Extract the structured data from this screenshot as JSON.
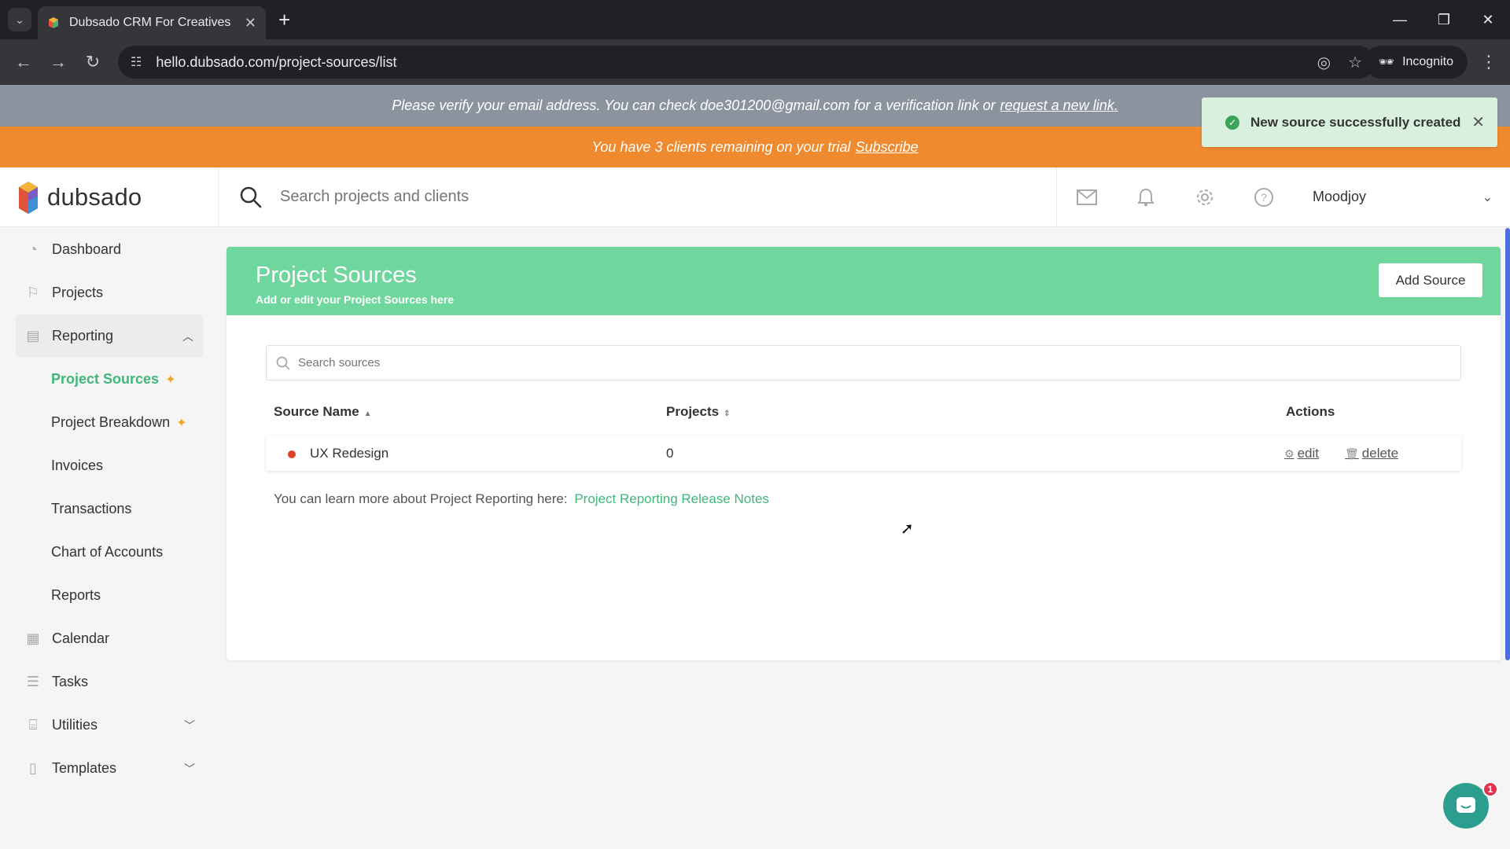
{
  "browser": {
    "tab_title": "Dubsado CRM For Creatives",
    "url": "hello.dubsado.com/project-sources/list",
    "incognito_label": "Incognito"
  },
  "banners": {
    "verify_text": "Please verify your email address. You can check doe301200@gmail.com for a verification link or",
    "verify_link": "request a new link.",
    "trial_text": "You have 3 clients remaining on your trial",
    "trial_link": "Subscribe"
  },
  "toast": {
    "message": "New source successfully created"
  },
  "header": {
    "logo_text": "dubsado",
    "search_placeholder": "Search projects and clients",
    "user_name": "Moodjoy"
  },
  "sidebar": {
    "items": [
      {
        "label": "Dashboard",
        "icon": "dashboard-icon"
      },
      {
        "label": "Projects",
        "icon": "projects-icon"
      },
      {
        "label": "Reporting",
        "icon": "reporting-icon"
      },
      {
        "label": "Project Sources"
      },
      {
        "label": "Project Breakdown"
      },
      {
        "label": "Invoices"
      },
      {
        "label": "Transactions"
      },
      {
        "label": "Chart of Accounts"
      },
      {
        "label": "Reports"
      },
      {
        "label": "Calendar",
        "icon": "calendar-icon"
      },
      {
        "label": "Tasks",
        "icon": "tasks-icon"
      },
      {
        "label": "Utilities",
        "icon": "utilities-icon"
      },
      {
        "label": "Templates",
        "icon": "templates-icon"
      }
    ]
  },
  "main": {
    "title": "Project Sources",
    "subtitle": "Add or edit your Project Sources here",
    "add_button": "Add Source",
    "search_placeholder": "Search sources",
    "columns": [
      "Source Name",
      "Projects",
      "Actions"
    ],
    "rows": [
      {
        "name": "UX Redesign",
        "projects": "0",
        "dot_color": "#e0412a",
        "edit": "edit",
        "delete": "delete"
      }
    ],
    "learn_text": "You can learn more about Project Reporting here:",
    "learn_link": "Project Reporting Release Notes"
  },
  "chat": {
    "badge": "1"
  },
  "colors": {
    "accent_green": "#3fb77a",
    "header_green": "#6fd69e",
    "trial_orange": "#ef8a2e",
    "verify_gray": "#8b949e"
  }
}
